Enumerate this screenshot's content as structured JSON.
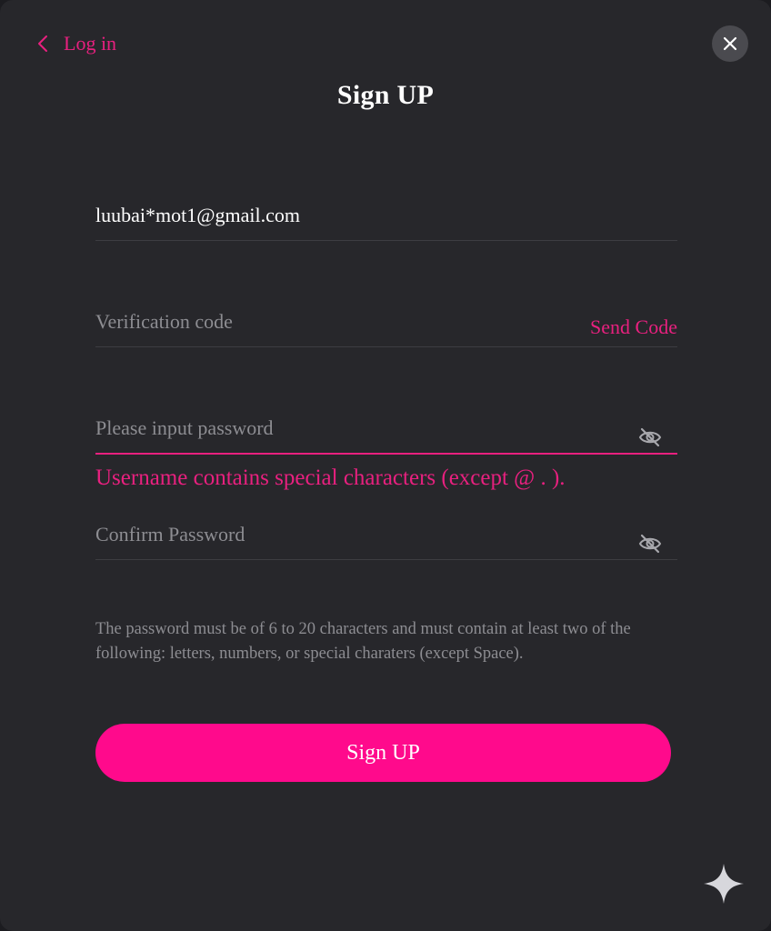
{
  "header": {
    "back_label": "Log in",
    "title": "Sign UP",
    "back_icon": "chevron-left-icon",
    "close_icon": "close-icon"
  },
  "form": {
    "email": {
      "value": "luubai*mot1@gmail.com"
    },
    "verification": {
      "placeholder": "Verification code",
      "send_code_label": "Send Code"
    },
    "password": {
      "placeholder": "Please input password",
      "toggle_icon": "eye-off-icon"
    },
    "error_message": "Username contains special characters (except @ . ).",
    "confirm_password": {
      "placeholder": "Confirm Password",
      "toggle_icon": "eye-off-icon"
    },
    "hint": "The password must be of 6 to 20 characters and must contain at least two of the following: letters, numbers, or special charaters (except Space).",
    "submit_label": "Sign UP"
  },
  "colors": {
    "accent": "#e8207f",
    "button": "#ff0a8c",
    "background": "#27272b"
  },
  "decorations": {
    "corner_icon": "sparkle-icon"
  }
}
